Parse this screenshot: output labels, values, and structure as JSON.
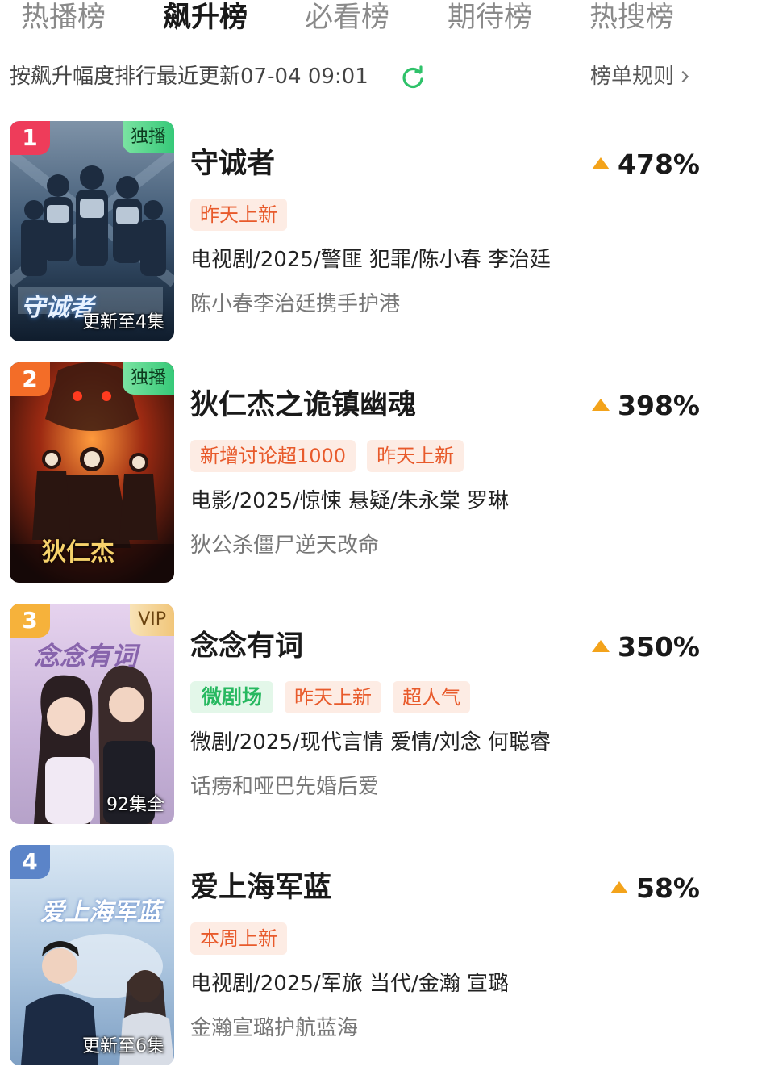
{
  "tabs": [
    {
      "label": "热播榜",
      "active": false
    },
    {
      "label": "飙升榜",
      "active": true
    },
    {
      "label": "必看榜",
      "active": false
    },
    {
      "label": "期待榜",
      "active": false
    },
    {
      "label": "热搜榜",
      "active": false
    }
  ],
  "subheader": {
    "description": "按飙升幅度排行最近更新07-04 09:01",
    "rules_label": "榜单规则"
  },
  "colors": {
    "accent_green": "#3fd57a",
    "growth_arrow": "#f3a31b",
    "badge_text": "#e85a2b",
    "rank_1": "#ee3c5a",
    "rank_2": "#f36d28",
    "rank_3": "#f6b23b",
    "rank_4": "#5b84c8"
  },
  "items": [
    {
      "rank": "1",
      "corner_tag": "独播",
      "poster_caption": "更新至4集",
      "title": "守诚者",
      "growth": "478%",
      "badges": [
        "昨天上新"
      ],
      "meta": "电视剧/2025/警匪 犯罪/陈小春 李治廷",
      "description": "陈小春李治廷携手护港"
    },
    {
      "rank": "2",
      "corner_tag": "独播",
      "poster_caption": "",
      "title": "狄仁杰之诡镇幽魂",
      "growth": "398%",
      "badges": [
        "新增讨论超1000",
        "昨天上新"
      ],
      "meta": "电影/2025/惊悚 悬疑/朱永棠 罗琳",
      "description": "狄公杀僵尸逆天改命"
    },
    {
      "rank": "3",
      "corner_tag": "VIP",
      "poster_caption": "92集全",
      "title": "念念有词",
      "growth": "350%",
      "micro_badge": "微剧场",
      "badges": [
        "昨天上新",
        "超人气"
      ],
      "meta": "微剧/2025/现代言情 爱情/刘念 何聪睿",
      "description": "话痨和哑巴先婚后爱"
    },
    {
      "rank": "4",
      "corner_tag": "",
      "poster_caption": "更新至6集",
      "title": "爱上海军蓝",
      "growth": "58%",
      "badges": [
        "本周上新"
      ],
      "meta": "电视剧/2025/军旅 当代/金瀚 宣璐",
      "description": "金瀚宣璐护航蓝海"
    }
  ]
}
